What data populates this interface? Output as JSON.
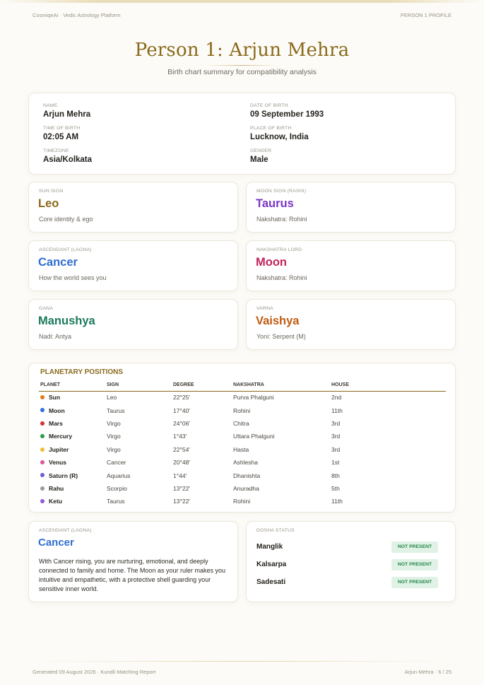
{
  "header": {
    "left": "CosmiqeAI · Vedic Astrology Platform",
    "right": "PERSON 1 PROFILE"
  },
  "title": "Person 1: Arjun Mehra",
  "subtitle": "Birth chart summary for compatibility analysis",
  "info": {
    "name_label": "NAME",
    "name": "Arjun Mehra",
    "dob_label": "DATE OF BIRTH",
    "dob": "09 September 1993",
    "tob_label": "TIME OF BIRTH",
    "tob": "02:05 AM",
    "pob_label": "PLACE OF BIRTH",
    "pob": "Lucknow, India",
    "tz_label": "TIMEZONE",
    "tz": "Asia/Kolkata",
    "gender_label": "GENDER",
    "gender": "Male"
  },
  "signs": [
    {
      "label": "SUN SIGN",
      "value": "Leo",
      "desc": "Core identity & ego",
      "color": "#8a6a1c"
    },
    {
      "label": "MOON SIGN (RASHI)",
      "value": "Taurus",
      "desc": "Nakshatra: Rohini",
      "color": "#7b35c6"
    },
    {
      "label": "ASCENDANT (LAGNA)",
      "value": "Cancer",
      "desc": "How the world sees you",
      "color": "#2f6fce"
    },
    {
      "label": "NAKSHATRA LORD",
      "value": "Moon",
      "desc": "Nakshatra: Rohini",
      "color": "#c2255c"
    },
    {
      "label": "GANA",
      "value": "Manushya",
      "desc": "Nadi: Antya",
      "color": "#1c7a5e"
    },
    {
      "label": "VARNA",
      "value": "Vaishya",
      "desc": "Yoni: Serpent (M)",
      "color": "#c05b12"
    }
  ],
  "planets": {
    "title": "PLANETARY POSITIONS",
    "headers": [
      "PLANET",
      "SIGN",
      "DEGREE",
      "NAKSHATRA",
      "HOUSE"
    ],
    "rows": [
      {
        "planet": "Sun",
        "sign": "Leo",
        "degree": "22°25'",
        "nakshatra": "Purva Phalguni",
        "house": "2nd",
        "color": "#e07b1a"
      },
      {
        "planet": "Moon",
        "sign": "Taurus",
        "degree": "17°40'",
        "nakshatra": "Rohini",
        "house": "11th",
        "color": "#2f6fde"
      },
      {
        "planet": "Mars",
        "sign": "Virgo",
        "degree": "24°06'",
        "nakshatra": "Chitra",
        "house": "3rd",
        "color": "#d93030"
      },
      {
        "planet": "Mercury",
        "sign": "Virgo",
        "degree": "1°43'",
        "nakshatra": "Uttara Phalguni",
        "house": "3rd",
        "color": "#25a04a"
      },
      {
        "planet": "Jupiter",
        "sign": "Virgo",
        "degree": "22°54'",
        "nakshatra": "Hasta",
        "house": "3rd",
        "color": "#f2be2e"
      },
      {
        "planet": "Venus",
        "sign": "Cancer",
        "degree": "20°48'",
        "nakshatra": "Ashlesha",
        "house": "1st",
        "color": "#e0559a"
      },
      {
        "planet": "Saturn (R)",
        "sign": "Aquarius",
        "degree": "1°44'",
        "nakshatra": "Dhanishta",
        "house": "8th",
        "color": "#6a5fd6"
      },
      {
        "planet": "Rahu",
        "sign": "Scorpio",
        "degree": "13°22'",
        "nakshatra": "Anuradha",
        "house": "5th",
        "color": "#9a9a9a"
      },
      {
        "planet": "Ketu",
        "sign": "Taurus",
        "degree": "13°22'",
        "nakshatra": "Rohini",
        "house": "11th",
        "color": "#8f5ad8"
      }
    ]
  },
  "ascendant": {
    "label": "ASCENDANT (LAGNA)",
    "value": "Cancer",
    "text": "With Cancer rising, you are nurturing, emotional, and deeply connected to family and home. The Moon as your ruler makes you intuitive and empathetic, with a protective shell guarding your sensitive inner world.",
    "color": "#2f6fce"
  },
  "dosha": {
    "label": "DOSHA STATUS",
    "items": [
      {
        "name": "Manglik",
        "status": "NOT PRESENT"
      },
      {
        "name": "Kalsarpa",
        "status": "NOT PRESENT"
      },
      {
        "name": "Sadesati",
        "status": "NOT PRESENT"
      }
    ]
  },
  "footer": {
    "left": "Generated 09 August 2026 · Kundli Matching Report",
    "right": "Arjun Mehra · 6 / 25"
  }
}
